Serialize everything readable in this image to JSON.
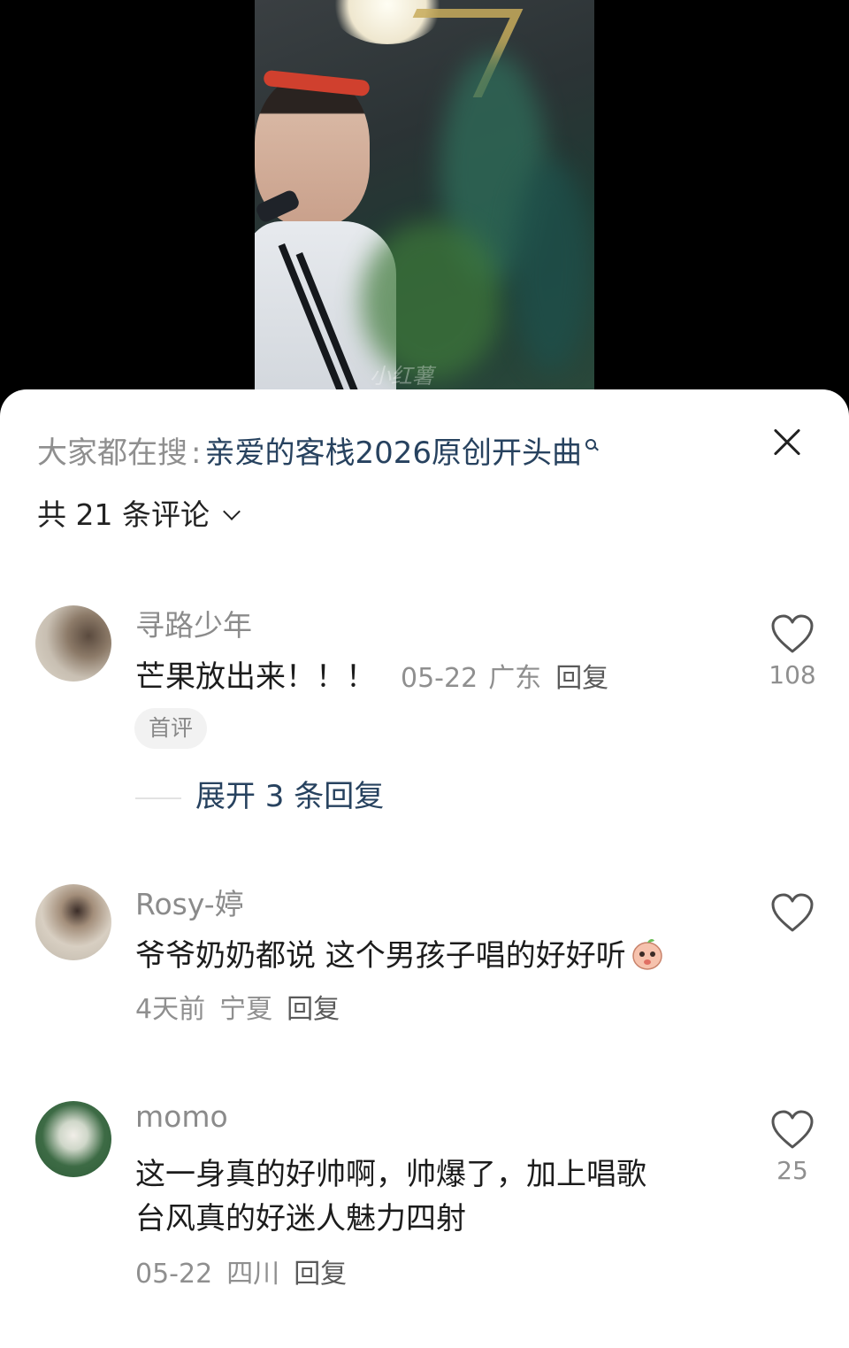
{
  "search": {
    "prefix": "大家都在搜",
    "separator": ":",
    "query": "亲爱的客栈2026原创开头曲"
  },
  "comments_header": {
    "count_label": "共 21 条评论"
  },
  "comments": [
    {
      "username": "寻路少年",
      "text": "芒果放出来！！！",
      "date": "05-22",
      "location": "广东",
      "reply_label": "回复",
      "badge": "首评",
      "expand_label": "展开 3 条回复",
      "likes": "108"
    },
    {
      "username": "Rosy-婷",
      "text": "爷爷奶奶都说 这个男孩子唱的好好听",
      "date": "4天前",
      "location": "宁夏",
      "reply_label": "回复",
      "likes": ""
    },
    {
      "username": "momo",
      "text_line1": "这一身真的好帅啊，帅爆了，加上唱歌",
      "text_line2": "台风真的好迷人魅力四射",
      "date": "05-22",
      "location": "四川",
      "reply_label": "回复",
      "likes": "25"
    }
  ],
  "video": {
    "watermark": "小红薯"
  },
  "colors": {
    "link": "#27425f",
    "meta": "#8f8f8f",
    "badge_bg": "#f2f2f2"
  },
  "icons": [
    "close-icon",
    "search-icon",
    "chevron-down-icon",
    "heart-icon",
    "emoji-icon"
  ]
}
